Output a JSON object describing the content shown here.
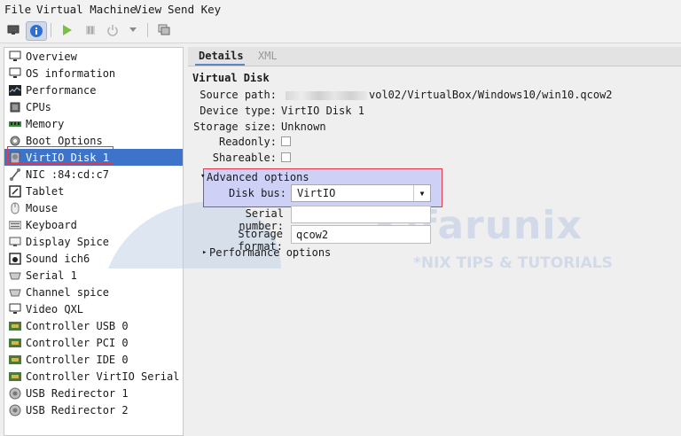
{
  "menu": [
    "File",
    "Virtual Machine",
    "View",
    "Send Key"
  ],
  "toolbar": {
    "items": [
      "monitor-icon",
      "info-icon",
      "run-icon",
      "pause-icon",
      "power-icon",
      "dropdown-icon",
      "migrate-icon"
    ],
    "active": "info-icon"
  },
  "sidebar": {
    "items": [
      {
        "label": "Overview",
        "icon": "monitor-icon"
      },
      {
        "label": "OS information",
        "icon": "monitor-icon"
      },
      {
        "label": "Performance",
        "icon": "performance-icon"
      },
      {
        "label": "CPUs",
        "icon": "cpu-icon"
      },
      {
        "label": "Memory",
        "icon": "memory-icon"
      },
      {
        "label": "Boot Options",
        "icon": "gear-icon"
      },
      {
        "label": "VirtIO Disk 1",
        "icon": "disk-icon"
      },
      {
        "label": "NIC :84:cd:c7",
        "icon": "network-icon"
      },
      {
        "label": "Tablet",
        "icon": "tablet-icon"
      },
      {
        "label": "Mouse",
        "icon": "mouse-icon"
      },
      {
        "label": "Keyboard",
        "icon": "keyboard-icon"
      },
      {
        "label": "Display Spice",
        "icon": "display-icon"
      },
      {
        "label": "Sound ich6",
        "icon": "sound-icon"
      },
      {
        "label": "Serial 1",
        "icon": "serial-icon"
      },
      {
        "label": "Channel spice",
        "icon": "channel-icon"
      },
      {
        "label": "Video QXL",
        "icon": "monitor-icon"
      },
      {
        "label": "Controller USB 0",
        "icon": "controller-icon"
      },
      {
        "label": "Controller PCI 0",
        "icon": "controller-icon"
      },
      {
        "label": "Controller IDE 0",
        "icon": "controller-icon"
      },
      {
        "label": "Controller VirtIO Serial 0",
        "icon": "controller-icon"
      },
      {
        "label": "USB Redirector 1",
        "icon": "usb-icon"
      },
      {
        "label": "USB Redirector 2",
        "icon": "usb-icon"
      }
    ],
    "selected": "VirtIO Disk 1"
  },
  "tabs": {
    "details": "Details",
    "xml": "XML"
  },
  "disk": {
    "title": "Virtual Disk",
    "source_label": "Source path:",
    "source_value": "vol02/VirtualBox/Windows10/win10.qcow2",
    "device_type_label": "Device type:",
    "device_type_value": "VirtIO Disk 1",
    "storage_size_label": "Storage size:",
    "storage_size_value": "Unknown",
    "readonly_label": "Readonly:",
    "shareable_label": "Shareable:"
  },
  "advanced": {
    "header": "Advanced options",
    "disk_bus_label": "Disk bus:",
    "disk_bus_value": "VirtIO",
    "serial_label": "Serial number:",
    "serial_value": "",
    "storage_format_label": "Storage format:",
    "storage_format_value": "qcow2"
  },
  "performance": {
    "header": "Performance options"
  },
  "watermark": {
    "brand": "Kifarunix",
    "tagline": "*NIX TIPS & TUTORIALS"
  }
}
